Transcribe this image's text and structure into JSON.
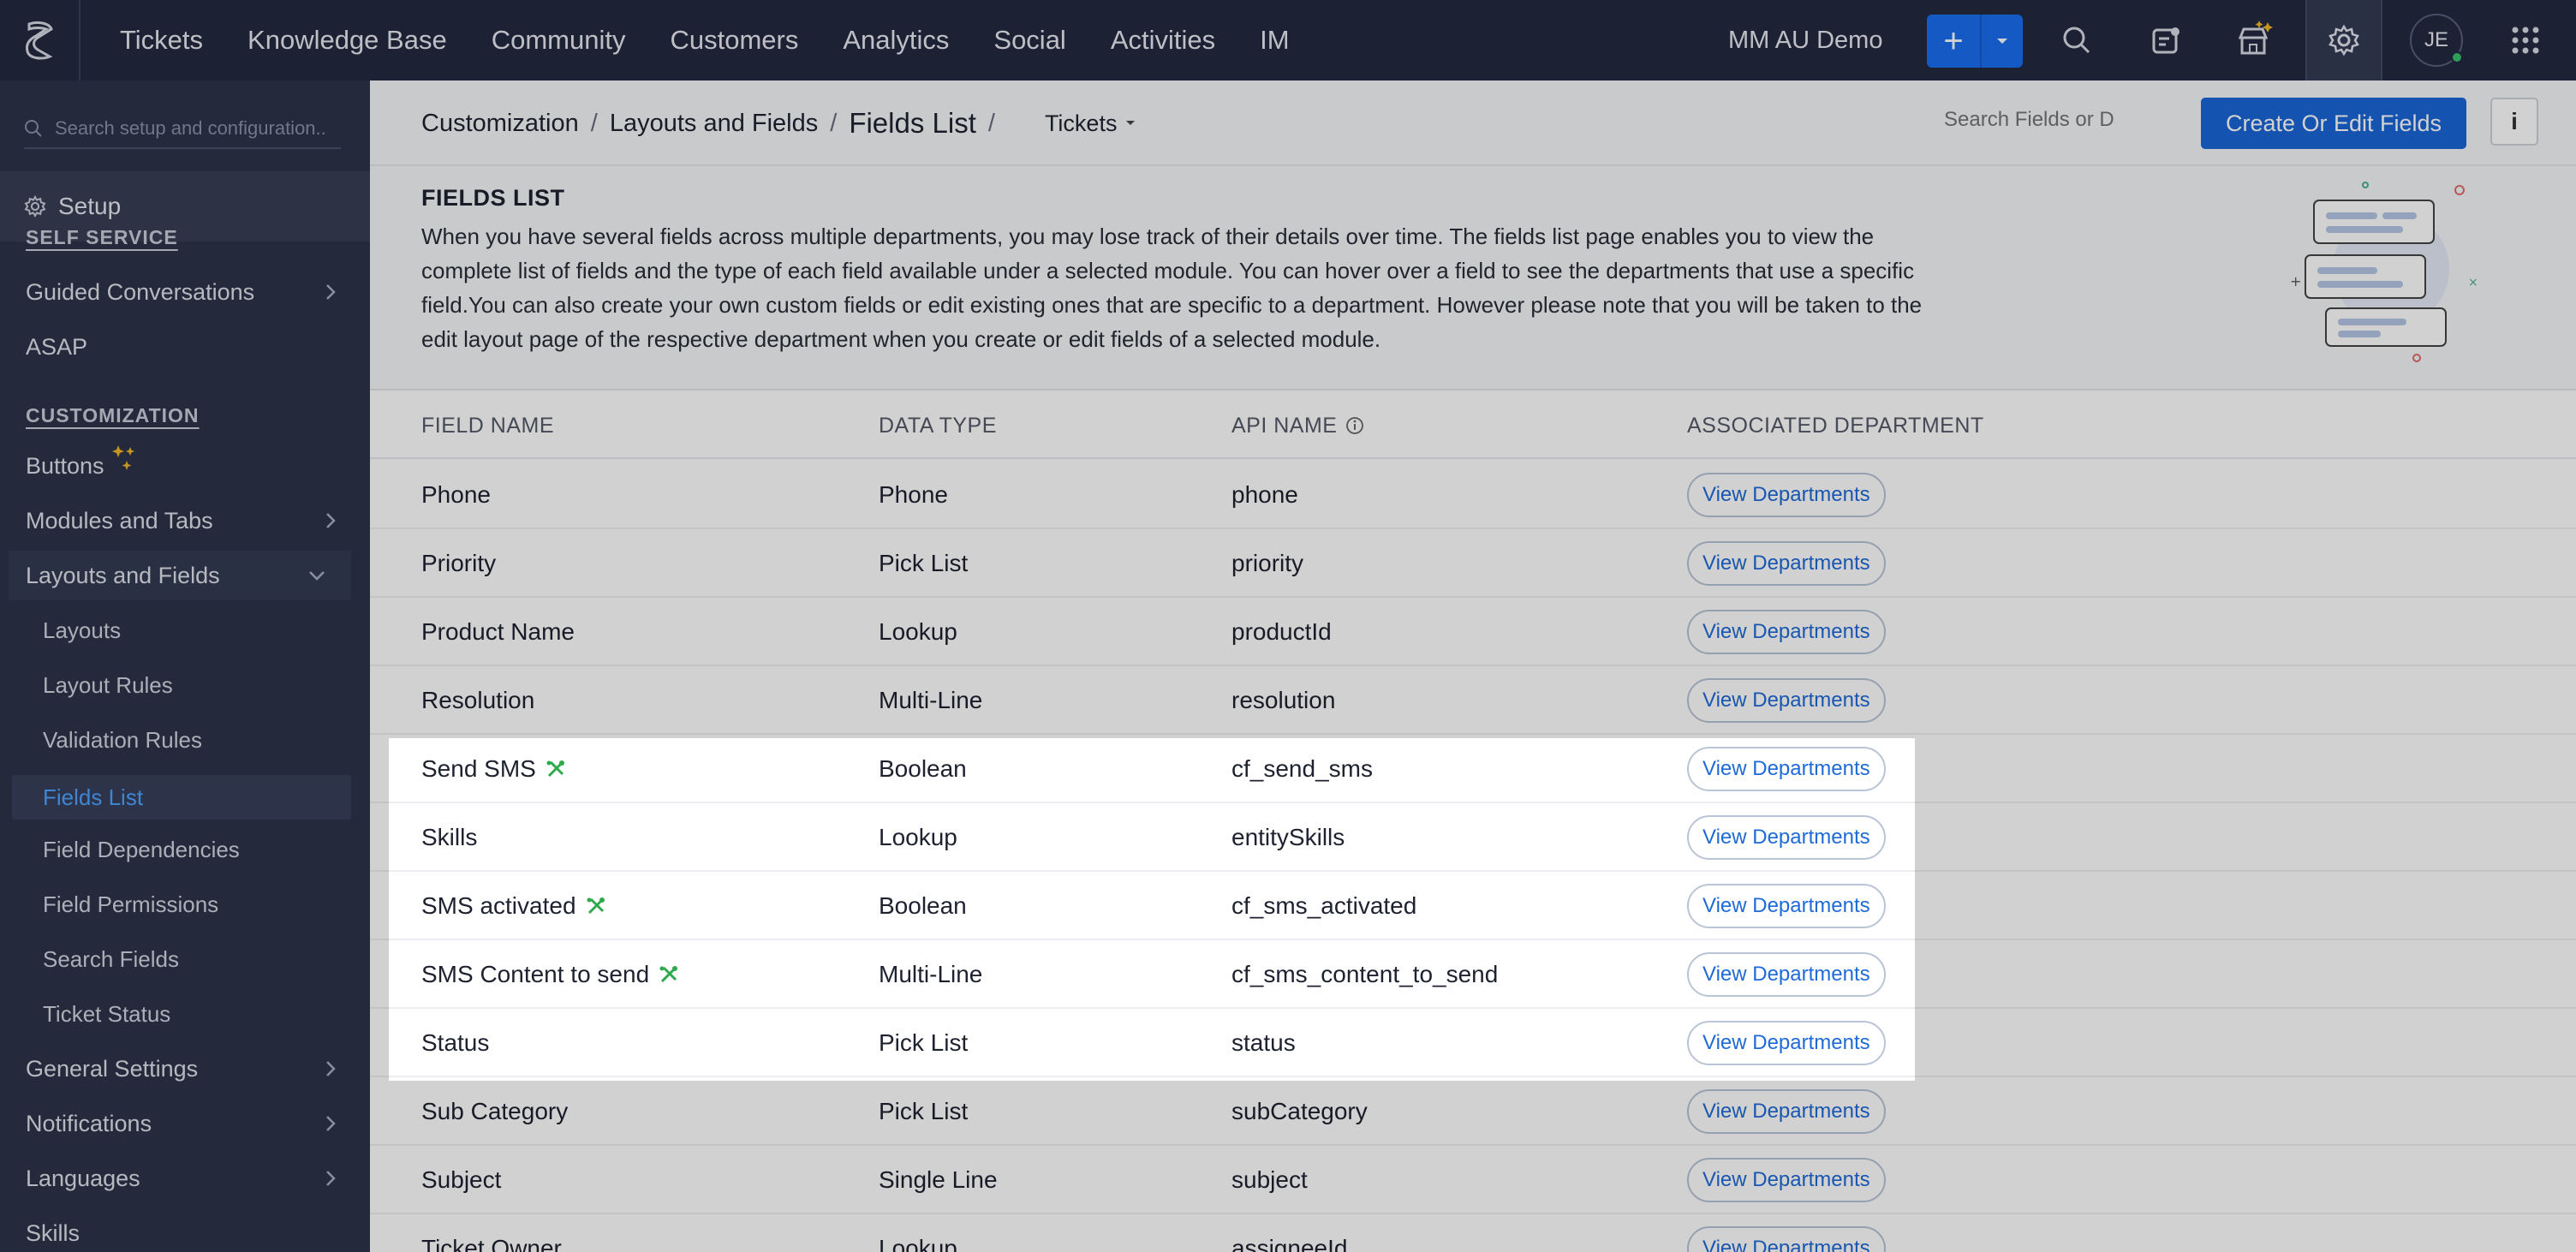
{
  "topbar": {
    "nav": [
      "Tickets",
      "Knowledge Base",
      "Community",
      "Customers",
      "Analytics",
      "Social",
      "Activities",
      "IM"
    ],
    "org_name": "MM AU Demo",
    "avatar_initials": "JE"
  },
  "sidebar": {
    "search_placeholder": "Search setup and configuration..",
    "setup_label": "Setup",
    "section_self_service": "SELF SERVICE",
    "self_service_items": [
      "Guided Conversations",
      "ASAP"
    ],
    "section_customization": "CUSTOMIZATION",
    "customization_items": [
      "Buttons",
      "Modules and Tabs",
      "Layouts and Fields"
    ],
    "layouts_sub_items": [
      "Layouts",
      "Layout Rules",
      "Validation Rules",
      "Fields List",
      "Field Dependencies",
      "Field Permissions",
      "Search Fields",
      "Ticket Status"
    ],
    "bottom_items": [
      "General Settings",
      "Notifications",
      "Languages",
      "Skills"
    ]
  },
  "breadcrumb": {
    "level1": "Customization",
    "level2": "Layouts and Fields",
    "current": "Fields List",
    "separator": "/",
    "module": "Tickets"
  },
  "toolbar": {
    "search_placeholder": "Search Fields or Data",
    "create_label": "Create Or Edit Fields",
    "info_label": "i"
  },
  "intro": {
    "title": "FIELDS LIST",
    "description": "When you have several fields across multiple departments, you may lose track of their details over time. The fields list page enables you to view the complete list of fields and the type of each field available under a selected module. You can hover over a field to see the departments that use a specific field.You can also create your own custom fields or edit existing ones that are specific to a department. However please note that you will be taken to the edit layout page of the respective department when you create or edit fields of a selected module."
  },
  "table": {
    "headers": {
      "field_name": "FIELD NAME",
      "data_type": "DATA TYPE",
      "api_name": "API NAME",
      "associated_department": "ASSOCIATED DEPARTMENT"
    },
    "view_label": "View Departments",
    "rows": [
      {
        "name": "Phone",
        "type": "Phone",
        "api": "phone",
        "custom": false
      },
      {
        "name": "Priority",
        "type": "Pick List",
        "api": "priority",
        "custom": false
      },
      {
        "name": "Product Name",
        "type": "Lookup",
        "api": "productId",
        "custom": false
      },
      {
        "name": "Resolution",
        "type": "Multi-Line",
        "api": "resolution",
        "custom": false
      },
      {
        "name": "Send SMS",
        "type": "Boolean",
        "api": "cf_send_sms",
        "custom": true
      },
      {
        "name": "Skills",
        "type": "Lookup",
        "api": "entitySkills",
        "custom": false
      },
      {
        "name": "SMS activated",
        "type": "Boolean",
        "api": "cf_sms_activated",
        "custom": true
      },
      {
        "name": "SMS Content to send",
        "type": "Multi-Line",
        "api": "cf_sms_content_to_send",
        "custom": true
      },
      {
        "name": "Status",
        "type": "Pick List",
        "api": "status",
        "custom": false
      },
      {
        "name": "Sub Category",
        "type": "Pick List",
        "api": "subCategory",
        "custom": false
      },
      {
        "name": "Subject",
        "type": "Single Line",
        "api": "subject",
        "custom": false
      },
      {
        "name": "Ticket Owner",
        "type": "Lookup",
        "api": "assigneeId",
        "custom": false
      }
    ]
  },
  "colors": {
    "topbar": "#232940",
    "sidebar": "#2c3249",
    "primary": "#1a66d8",
    "link": "#1e6ad7",
    "custom_icon": "#2ea94c"
  }
}
